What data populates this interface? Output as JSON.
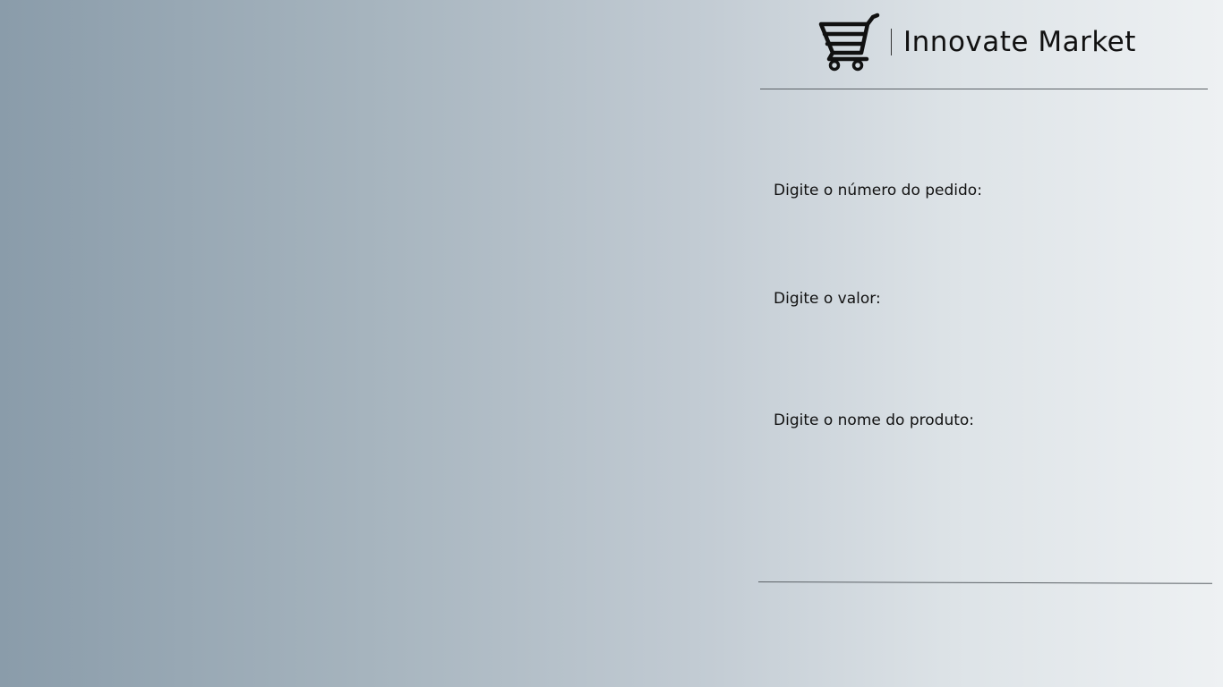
{
  "header": {
    "brand_name": "Innovate Market",
    "logo_icon": "shopping-cart-icon"
  },
  "form": {
    "fields": [
      {
        "label": "Digite o número do pedido:"
      },
      {
        "label": "Digite o valor:"
      },
      {
        "label": "Digite o nome do produto:"
      }
    ]
  },
  "colors": {
    "gradient_start": "#8a9caa",
    "gradient_end": "#eef1f3",
    "divider": "#5b6166",
    "text": "#111111"
  }
}
